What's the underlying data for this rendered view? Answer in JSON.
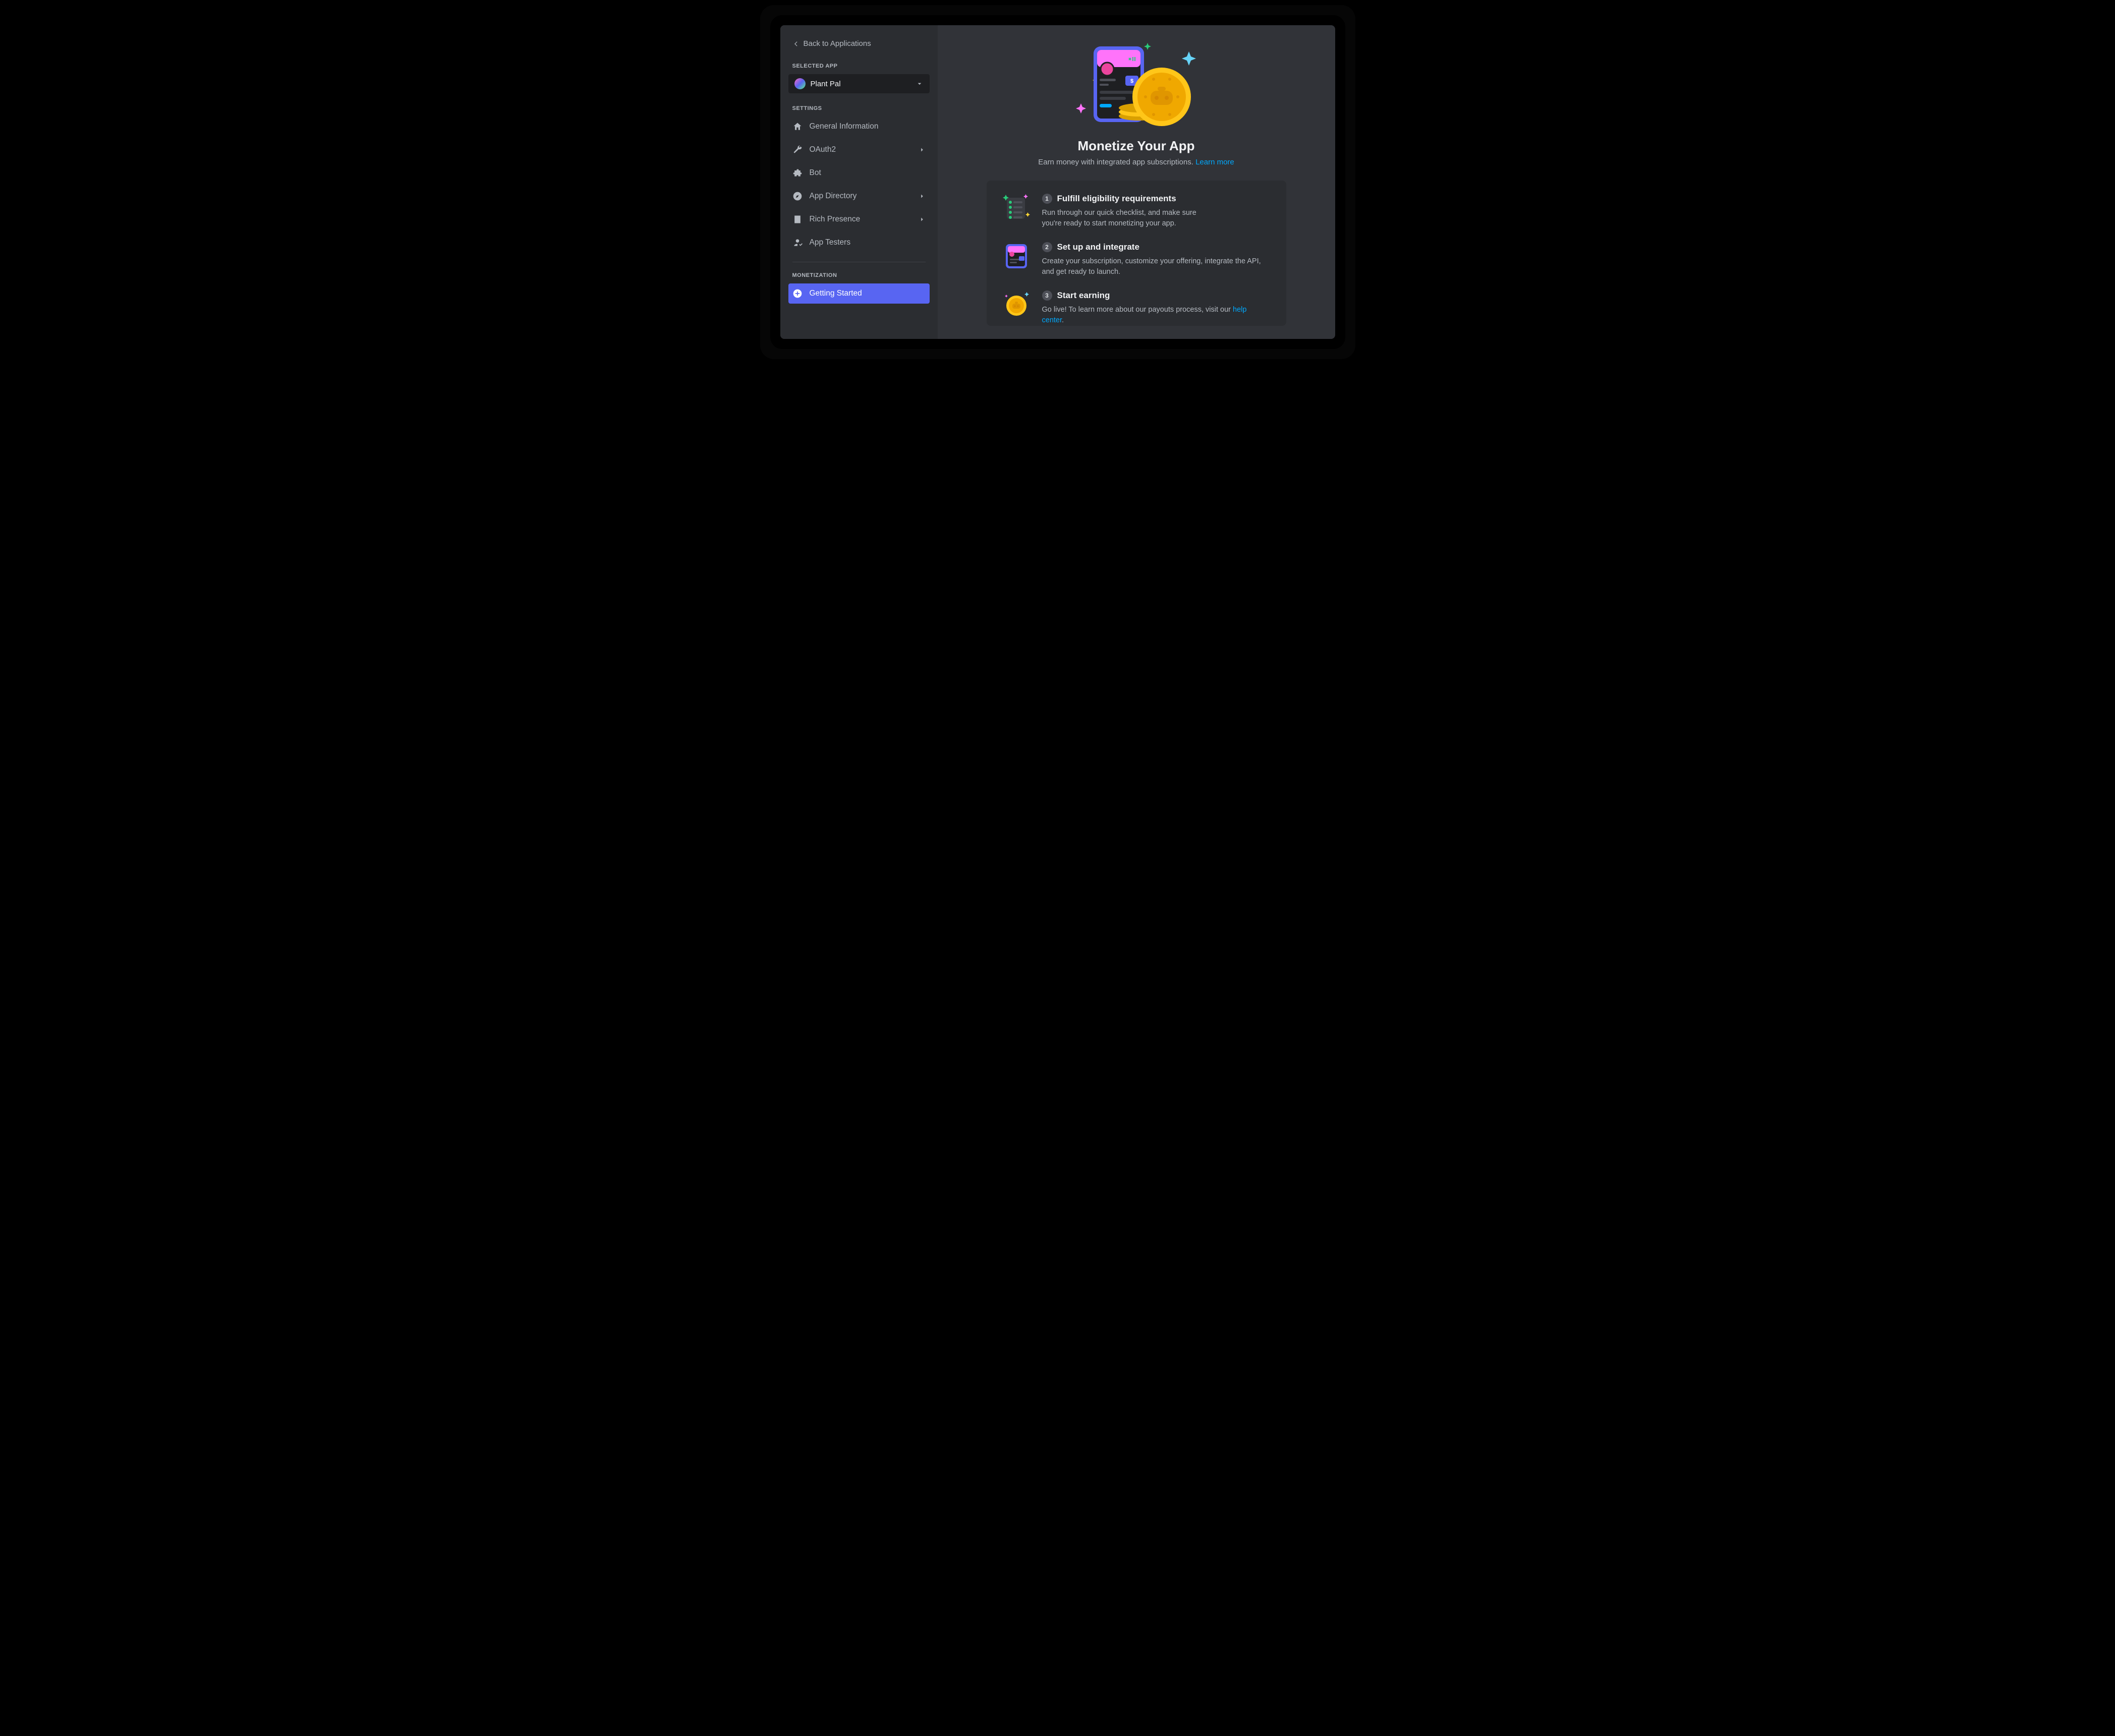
{
  "sidebar": {
    "back_label": "Back to Applications",
    "selected_label": "SELECTED APP",
    "app_name": "Plant Pal",
    "settings_label": "SETTINGS",
    "nav": {
      "general": "General Information",
      "oauth2": "OAuth2",
      "bot": "Bot",
      "appdir": "App Directory",
      "rich": "Rich Presence",
      "testers": "App Testers"
    },
    "monetization_label": "MONETIZATION",
    "getting_started": "Getting Started"
  },
  "main": {
    "title": "Monetize Your App",
    "subtitle_text": "Earn money with integrated app subscriptions. ",
    "subtitle_link": "Learn more",
    "steps": [
      {
        "num": "1",
        "title": "Fulfill eligibility requirements",
        "desc": "Run through our quick checklist, and make sure you're ready to start monetizing your app."
      },
      {
        "num": "2",
        "title": "Set up and integrate",
        "desc": "Create your subscription, customize your offering, integrate the API, and get ready to launch."
      },
      {
        "num": "3",
        "title": "Start earning",
        "desc_pre": "Go live! To learn more about our payouts process, visit our ",
        "desc_link": "help center",
        "desc_post": "."
      }
    ]
  }
}
